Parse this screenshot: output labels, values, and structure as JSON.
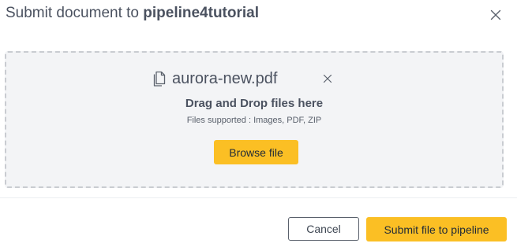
{
  "dialog": {
    "title_prefix": "Submit document to ",
    "pipeline_name": "pipeline4tutorial",
    "close_icon": "close-icon"
  },
  "dropzone": {
    "file_icon": "document-icon",
    "file_name": "aurora-new.pdf",
    "remove_icon": "close-icon",
    "drag_title": "Drag and Drop files here",
    "supported_text": "Files supported : Images, PDF, ZIP",
    "browse_label": "Browse file"
  },
  "footer": {
    "cancel_label": "Cancel",
    "submit_label": "Submit file to pipeline"
  },
  "colors": {
    "accent": "#fbbf24",
    "dropzone_bg": "#f3f4f6",
    "dropzone_border": "#c9ccd1",
    "text": "#4b5260"
  }
}
